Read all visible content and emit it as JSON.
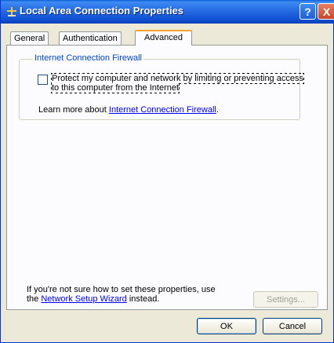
{
  "window": {
    "title": "Local Area Connection Properties",
    "help_label": "?",
    "close_label": "X"
  },
  "tabs": [
    {
      "label": "General",
      "active": false
    },
    {
      "label": "Authentication",
      "active": false
    },
    {
      "label": "Advanced",
      "active": true
    }
  ],
  "firewall": {
    "group_title": "Internet Connection Firewall",
    "checkbox_label": "Protect my computer and network by limiting or preventing access to this computer from the Internet",
    "checkbox_checked": false,
    "learn_prefix": "Learn more about ",
    "learn_link": "Internet Connection Firewall",
    "learn_suffix": "."
  },
  "wizard": {
    "line1": "If you're not sure how to set these properties, use",
    "prefix": "the ",
    "link": "Network Setup Wizard",
    "suffix": " instead."
  },
  "buttons": {
    "settings": "Settings...",
    "ok": "OK",
    "cancel": "Cancel"
  },
  "colors": {
    "titlebar": "#0a5fd8",
    "dialog_bg": "#ece9d8",
    "group_title": "#0046d5",
    "link": "#0000ff",
    "active_tab_accent": "#f7a431"
  }
}
